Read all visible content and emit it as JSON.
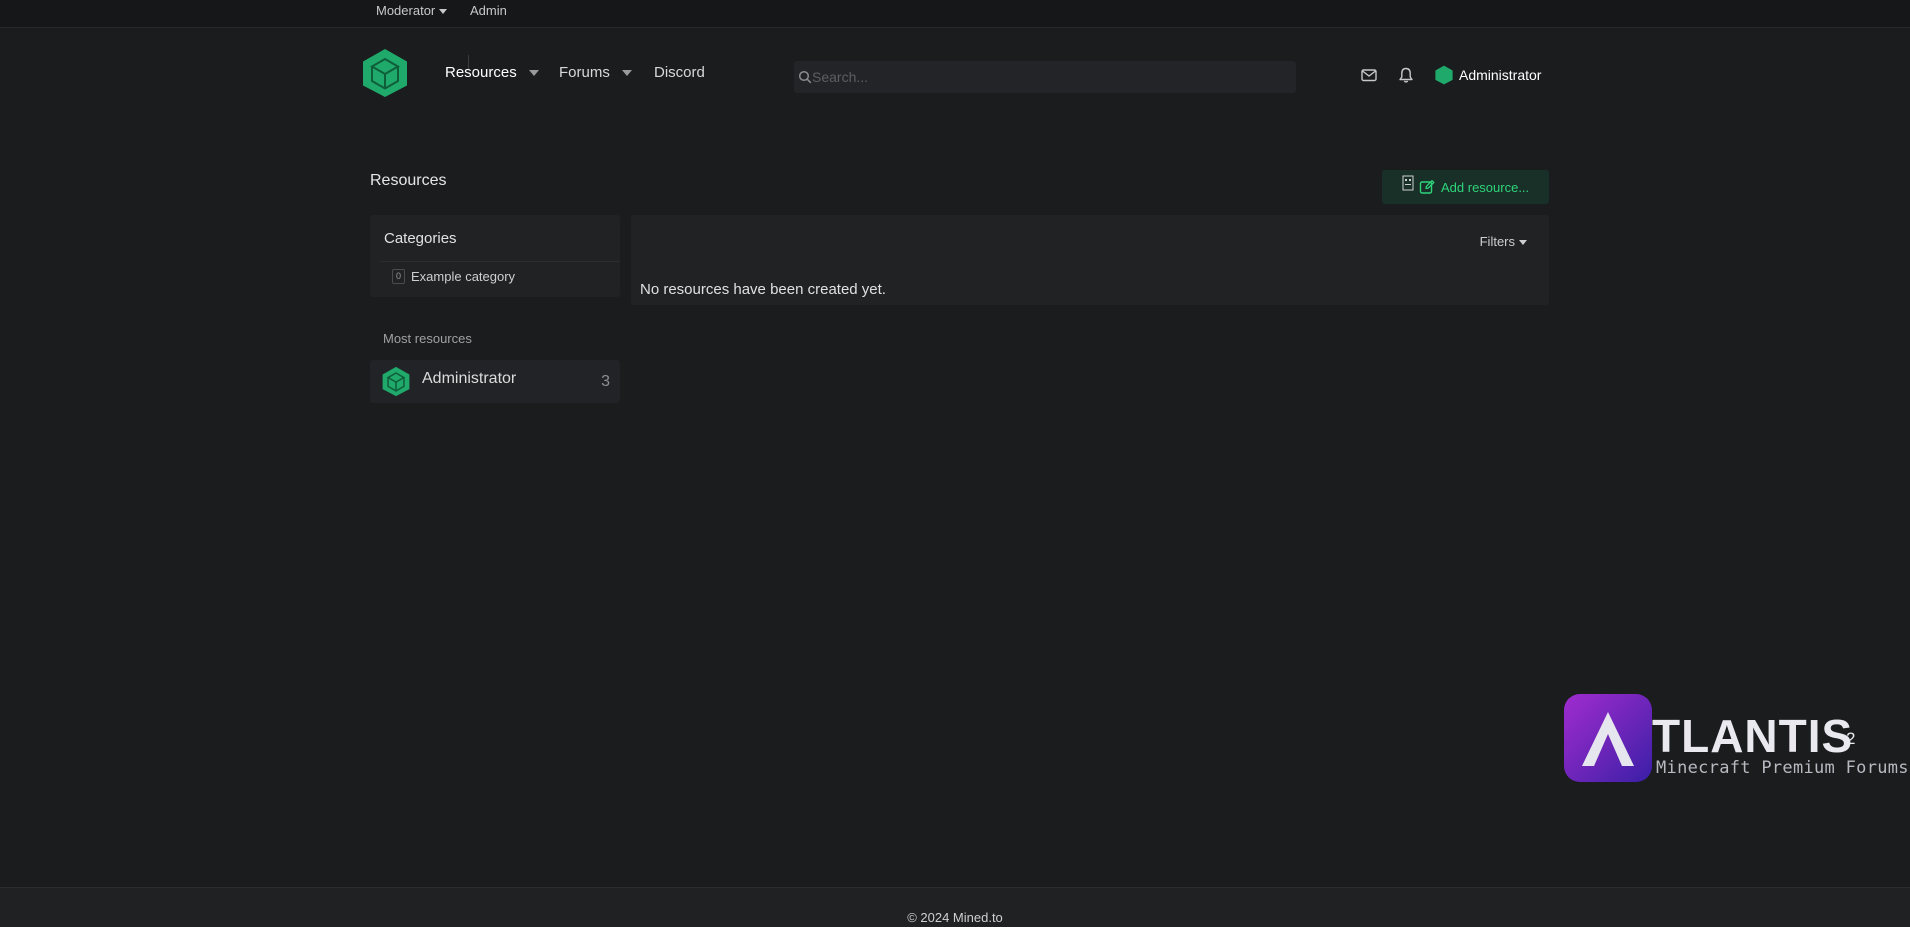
{
  "staffbar": {
    "moderator_label": "Moderator",
    "admin_label": "Admin"
  },
  "nav": {
    "resources": "Resources",
    "forums": "Forums",
    "discord": "Discord"
  },
  "search": {
    "placeholder": "Search..."
  },
  "user": {
    "name": "Administrator"
  },
  "page": {
    "title": "Resources",
    "add_button": "Add resource..."
  },
  "sidebar": {
    "categories_title": "Categories",
    "categories": [
      {
        "count": "0",
        "label": "Example category"
      }
    ],
    "most_title": "Most resources",
    "most": [
      {
        "name": "Administrator",
        "count": "3"
      }
    ]
  },
  "main": {
    "filters_label": "Filters",
    "empty_message": "No resources have been created yet."
  },
  "watermark": {
    "title": "TLANTIS",
    "sup": "2",
    "subtitle": "Minecraft Premium Forums"
  },
  "footer": {
    "copyright": "© 2024 Mined.to"
  },
  "colors": {
    "accent": "#2ed47a",
    "background": "#1b1c1e",
    "panel": "#212224"
  },
  "icons": [
    "logo-cube-icon",
    "search-icon",
    "mail-icon",
    "bell-icon",
    "edit-icon",
    "avatar-icon"
  ]
}
